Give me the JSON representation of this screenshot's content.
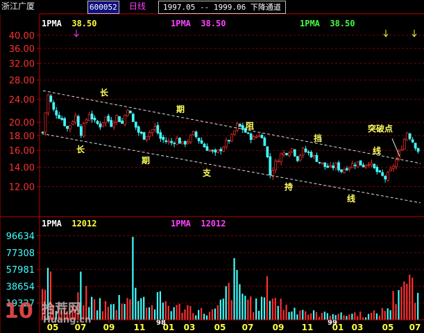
{
  "header": {
    "stock_name": "浙江广厦",
    "stock_code": "600052",
    "period": "日线",
    "date_range": "1997.05 -- 1999.06  下降通道"
  },
  "price_panel": {
    "ma_labels": [
      {
        "name": "1PMA",
        "value": "38.50",
        "color": "#ffffff",
        "value_color": "#ffff40"
      },
      {
        "name": "1PMA",
        "value": "38.50",
        "color": "#ff40ff",
        "value_color": "#ff40ff"
      },
      {
        "name": "1PMA",
        "value": "38.50",
        "color": "#40ff40",
        "value_color": "#40ff40"
      }
    ],
    "annotations": [
      "长",
      "长",
      "期",
      "期",
      "阻",
      "支",
      "挡",
      "持",
      "线",
      "线",
      "突破点"
    ]
  },
  "volume_panel": {
    "ma_labels": [
      {
        "name": "1PMA",
        "value": "12012",
        "color": "#ffffff",
        "value_color": "#ffff40"
      },
      {
        "name": "1PMA",
        "value": "12012",
        "color": "#ff40ff",
        "value_color": "#ff40ff"
      }
    ]
  },
  "watermark": {
    "logo": "10",
    "text": "拾荒网",
    "url": "Huang.cn"
  },
  "colors": {
    "up": "#ff3030",
    "down": "#40ffff",
    "axis": "#c00000",
    "grid": "#800000"
  },
  "chart_data": [
    {
      "type": "candlestick",
      "y_scale": "log",
      "ylim": [
        10.6,
        42
      ],
      "yticks": [
        "40.00",
        "36.00",
        "32.00",
        "28.00",
        "24.00",
        "20.00",
        "18.00",
        "16.00",
        "14.00",
        "12.00"
      ],
      "x_tick_labels": [
        "05",
        "07",
        "09",
        "11",
        "01",
        "03",
        "05",
        "07",
        "09",
        "11",
        "01",
        "03",
        "05",
        "07"
      ],
      "year_labels": [
        "98",
        "99"
      ],
      "close_path": [
        [
          0,
          18.5
        ],
        [
          2,
          24.8
        ],
        [
          4,
          22.0
        ],
        [
          7,
          20.5
        ],
        [
          9,
          19.0
        ],
        [
          12,
          21.0
        ],
        [
          14,
          18.4
        ],
        [
          17,
          21.5
        ],
        [
          19,
          20.0
        ],
        [
          21,
          19.5
        ],
        [
          23,
          20.8
        ],
        [
          25,
          19.7
        ],
        [
          27,
          21.0
        ],
        [
          29,
          19.8
        ],
        [
          31,
          22.5
        ],
        [
          33,
          20.0
        ],
        [
          35,
          18.5
        ],
        [
          37,
          17.8
        ],
        [
          39,
          18.5
        ],
        [
          41,
          19.2
        ],
        [
          43,
          17.6
        ],
        [
          45,
          17.2
        ],
        [
          47,
          17.0
        ],
        [
          49,
          17.5
        ],
        [
          51,
          16.8
        ],
        [
          53,
          17.3
        ],
        [
          55,
          18.3
        ],
        [
          57,
          17.4
        ],
        [
          59,
          16.5
        ],
        [
          61,
          16.0
        ],
        [
          63,
          15.5
        ],
        [
          65,
          16.2
        ],
        [
          67,
          17.0
        ],
        [
          69,
          17.8
        ],
        [
          71,
          19.5
        ],
        [
          73,
          19.0
        ],
        [
          75,
          18.0
        ],
        [
          77,
          17.6
        ],
        [
          79,
          18.2
        ],
        [
          81,
          17.0
        ],
        [
          83,
          13.2
        ],
        [
          85,
          14.5
        ],
        [
          87,
          15.5
        ],
        [
          89,
          15.8
        ],
        [
          91,
          16.2
        ],
        [
          93,
          15.0
        ],
        [
          95,
          16.0
        ],
        [
          97,
          15.7
        ],
        [
          99,
          15.2
        ],
        [
          101,
          14.6
        ],
        [
          103,
          14.1
        ],
        [
          105,
          13.9
        ],
        [
          107,
          14.2
        ],
        [
          109,
          13.6
        ],
        [
          111,
          14.0
        ],
        [
          113,
          14.3
        ],
        [
          115,
          14.5
        ],
        [
          117,
          14.2
        ],
        [
          119,
          14.6
        ],
        [
          121,
          13.8
        ],
        [
          123,
          13.2
        ],
        [
          125,
          12.8
        ],
        [
          127,
          13.6
        ],
        [
          129,
          14.8
        ],
        [
          131,
          16.5
        ],
        [
          133,
          18.5
        ],
        [
          135,
          17.2
        ],
        [
          137,
          16.0
        ]
      ]
    },
    {
      "type": "bar",
      "ylim": [
        0,
        105000
      ],
      "yticks": [
        "96634",
        "77308",
        "57981",
        "38654",
        "19327"
      ],
      "profile": [
        [
          0,
          32000
        ],
        [
          2,
          65000
        ],
        [
          4,
          30000
        ],
        [
          6,
          20000
        ],
        [
          9,
          15000
        ],
        [
          12,
          18000
        ],
        [
          14,
          45000
        ],
        [
          17,
          25000
        ],
        [
          20,
          25000
        ],
        [
          23,
          20000
        ],
        [
          26,
          18000
        ],
        [
          28,
          30000
        ],
        [
          30,
          40000
        ],
        [
          32,
          28000
        ],
        [
          33,
          92000
        ],
        [
          34,
          60000
        ],
        [
          36,
          35000
        ],
        [
          38,
          25000
        ],
        [
          40,
          18000
        ],
        [
          43,
          30000
        ],
        [
          46,
          22000
        ],
        [
          49,
          16000
        ],
        [
          52,
          20000
        ],
        [
          55,
          15000
        ],
        [
          58,
          12000
        ],
        [
          61,
          10000
        ],
        [
          64,
          15000
        ],
        [
          67,
          35000
        ],
        [
          70,
          60000
        ],
        [
          72,
          45000
        ],
        [
          75,
          30000
        ],
        [
          78,
          20000
        ],
        [
          80,
          25000
        ],
        [
          83,
          50000
        ],
        [
          85,
          30000
        ],
        [
          88,
          20000
        ],
        [
          91,
          14000
        ],
        [
          94,
          18000
        ],
        [
          97,
          10000
        ],
        [
          100,
          9000
        ],
        [
          103,
          8000
        ],
        [
          106,
          12000
        ],
        [
          109,
          7000
        ],
        [
          112,
          8000
        ],
        [
          115,
          10000
        ],
        [
          118,
          6000
        ],
        [
          121,
          9000
        ],
        [
          124,
          12000
        ],
        [
          127,
          20000
        ],
        [
          129,
          38000
        ],
        [
          131,
          65000
        ],
        [
          133,
          48000
        ],
        [
          135,
          45000
        ],
        [
          137,
          25000
        ]
      ]
    }
  ]
}
